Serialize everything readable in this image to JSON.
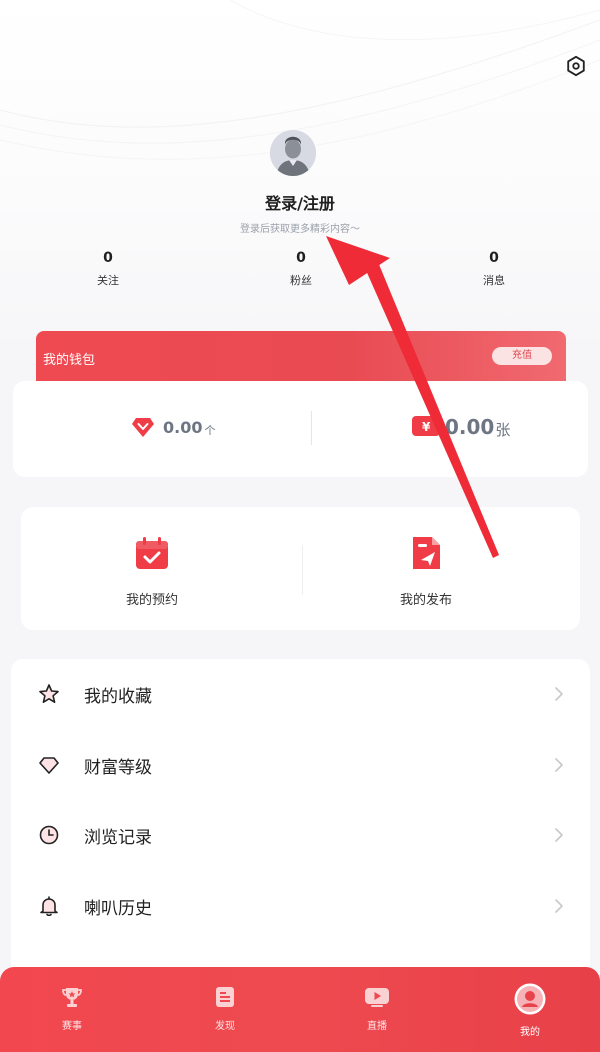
{
  "header": {
    "login_title": "登录/注册",
    "login_subtitle": "登录后获取更多精彩内容～"
  },
  "stats": [
    {
      "value": "0",
      "label": "关注"
    },
    {
      "value": "0",
      "label": "粉丝"
    },
    {
      "value": "0",
      "label": "消息"
    }
  ],
  "wallet": {
    "title": "我的钱包",
    "recharge_label": "充值",
    "diamond_value": "0.00",
    "diamond_unit": "个",
    "coupon_value": "0.00",
    "coupon_unit": "张"
  },
  "actions": [
    {
      "label": "我的预约",
      "icon": "calendar-check-icon"
    },
    {
      "label": "我的发布",
      "icon": "publish-send-icon"
    }
  ],
  "menu": [
    {
      "label": "我的收藏",
      "icon": "star-icon"
    },
    {
      "label": "财富等级",
      "icon": "diamond-icon"
    },
    {
      "label": "浏览记录",
      "icon": "clock-icon"
    },
    {
      "label": "喇叭历史",
      "icon": "bell-icon"
    }
  ],
  "tabbar": [
    {
      "label": "赛事",
      "icon": "trophy-icon"
    },
    {
      "label": "发现",
      "icon": "document-icon"
    },
    {
      "label": "直播",
      "icon": "play-icon"
    },
    {
      "label": "我的",
      "icon": "profile-icon"
    }
  ],
  "colors": {
    "accent": "#e94b53",
    "icon_red": "#ef3c46"
  }
}
